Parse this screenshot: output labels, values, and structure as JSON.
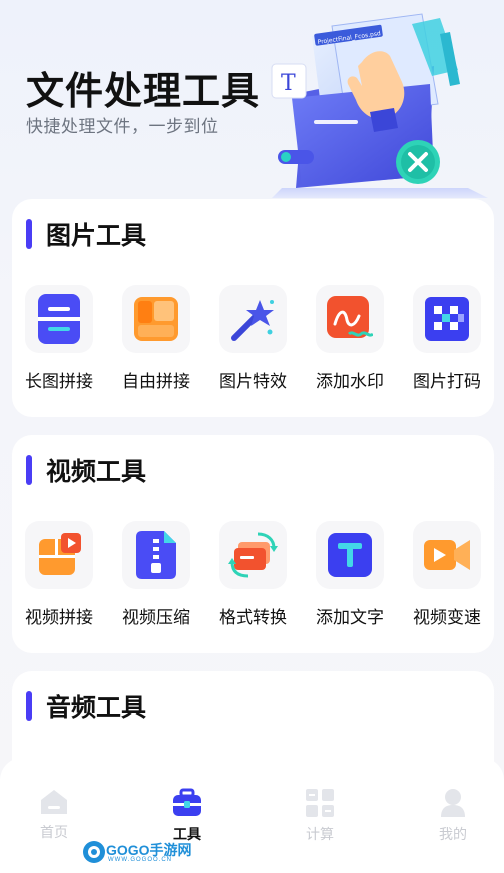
{
  "hero": {
    "title": "文件处理工具",
    "subtitle": "快捷处理文件，一步到位",
    "art_file_label": "ProjectFinal_Fcos.psd",
    "art_letter": "T"
  },
  "sections": [
    {
      "title": "图片工具",
      "items": [
        {
          "label": "长图拼接",
          "icon": "long-image-stitch-icon"
        },
        {
          "label": "自由拼接",
          "icon": "free-stitch-icon"
        },
        {
          "label": "图片特效",
          "icon": "magic-wand-icon"
        },
        {
          "label": "添加水印",
          "icon": "watermark-icon"
        },
        {
          "label": "图片打码",
          "icon": "mosaic-icon"
        }
      ]
    },
    {
      "title": "视频工具",
      "items": [
        {
          "label": "视频拼接",
          "icon": "video-stitch-icon"
        },
        {
          "label": "视频压缩",
          "icon": "zip-icon"
        },
        {
          "label": "格式转换",
          "icon": "format-convert-icon"
        },
        {
          "label": "添加文字",
          "icon": "text-icon"
        },
        {
          "label": "视频变速",
          "icon": "video-speed-icon"
        }
      ]
    },
    {
      "title": "音频工具",
      "items": []
    }
  ],
  "nav": {
    "items": [
      {
        "label": "首页",
        "icon": "home-icon",
        "active": false
      },
      {
        "label": "工具",
        "icon": "toolbox-icon",
        "active": true
      },
      {
        "label": "计算",
        "icon": "grid-icon",
        "active": false
      },
      {
        "label": "我的",
        "icon": "user-icon",
        "active": false
      }
    ]
  },
  "watermark": {
    "text": "GOGO手游网",
    "sub": "WWW.GOGOO.CN"
  },
  "colors": {
    "accent": "#4a3df5",
    "orange": "#ff8a1f",
    "red": "#f25a3a",
    "blue": "#3b3ff0"
  }
}
